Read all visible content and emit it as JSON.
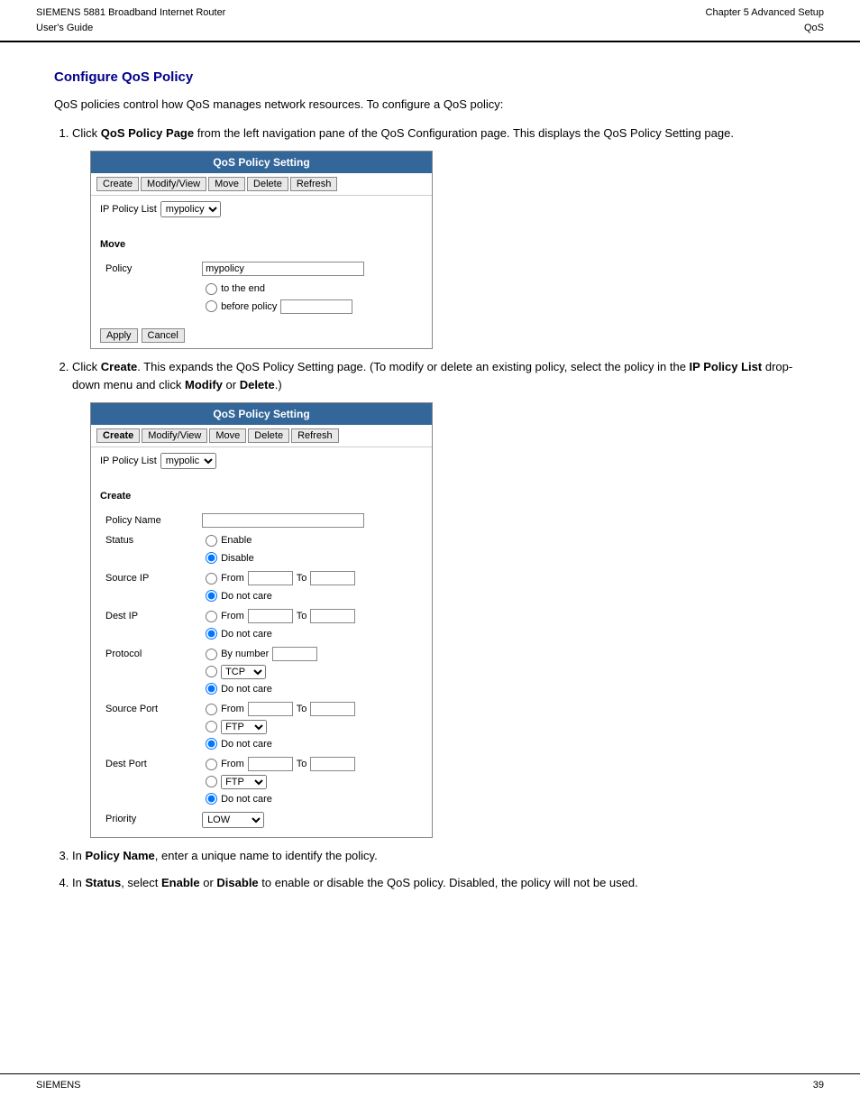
{
  "header": {
    "left_line1": "SIEMENS 5881 Broadband Internet Router",
    "left_line2": "User's Guide",
    "right_line1": "Chapter 5  Advanced Setup",
    "right_line2": "QoS"
  },
  "footer": {
    "left": "SIEMENS",
    "right": "39"
  },
  "section": {
    "title": "Configure QoS Policy",
    "intro": "QoS policies control how QoS manages network resources. To configure a QoS policy:"
  },
  "steps": [
    {
      "number": "1",
      "text_pre": "Click ",
      "bold1": "QoS Policy Page",
      "text_mid": " from the left navigation pane of the QoS Configuration page. This displays the QoS Policy Setting page.",
      "text_post": ""
    },
    {
      "number": "2",
      "text_pre": "Click ",
      "bold1": "Create",
      "text_mid": ". This expands the QoS Policy Setting page. (To modify or delete an existing policy, select the policy in the ",
      "bold2": "IP Policy List",
      "text_mid2": " drop-down menu and click ",
      "bold3": "Modify",
      "text_mid3": " or ",
      "bold4": "Delete",
      "text_post": ".)"
    },
    {
      "number": "3",
      "text_pre": "In ",
      "bold1": "Policy Name",
      "text_post": ", enter a unique name to identify the policy."
    },
    {
      "number": "4",
      "text_pre": "In ",
      "bold1": "Status",
      "text_mid": ", select ",
      "bold2": "Enable",
      "text_mid2": " or ",
      "bold3": "Disable",
      "text_post": " to enable or disable the QoS policy. Disabled, the policy will not be used."
    }
  ],
  "panel1": {
    "title": "QoS Policy Setting",
    "buttons": [
      "Create",
      "Modify/View",
      "Move",
      "Delete",
      "Refresh"
    ],
    "ip_policy_label": "IP Policy List",
    "ip_policy_value": "mypolicy",
    "move_section": "Move",
    "policy_label": "Policy",
    "policy_value": "mypolicy",
    "to_end_label": "to the end",
    "before_policy_label": "before policy",
    "apply_btn": "Apply",
    "cancel_btn": "Cancel"
  },
  "panel2": {
    "title": "QoS Policy Setting",
    "buttons": [
      "Create",
      "Modify/View",
      "Move",
      "Delete",
      "Refresh"
    ],
    "ip_policy_label": "IP Policy List",
    "ip_policy_value": "mypolic",
    "create_section": "Create",
    "fields": {
      "policy_name": "Policy Name",
      "status": "Status",
      "status_enable": "Enable",
      "status_disable": "Disable",
      "source_ip": "Source IP",
      "from_label": "From",
      "to_label": "To",
      "do_not_care": "Do not care",
      "dest_ip": "Dest IP",
      "protocol": "Protocol",
      "by_number": "By number",
      "tcp_label": "TCP",
      "source_port": "Source Port",
      "ftp_label": "FTP",
      "dest_port": "Dest Port",
      "priority": "Priority",
      "low_label": "LOW"
    }
  }
}
